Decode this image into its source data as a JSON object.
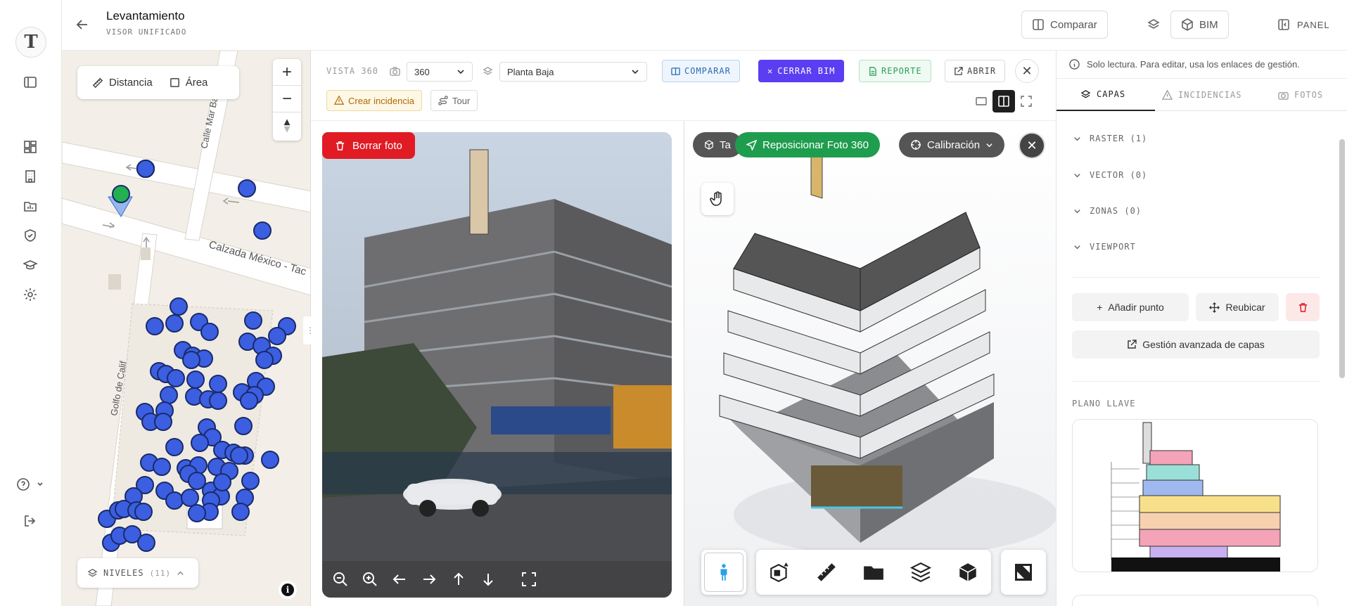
{
  "header": {
    "title": "Levantamiento",
    "subtitle": "VISOR UNIFICADO",
    "compare_label": "Comparar",
    "bim_label": "BIM",
    "panel_label": "PANEL"
  },
  "rail": {
    "logo_letter": "T",
    "icons": [
      "sidebar-toggle-icon",
      "dashboard-icon",
      "building-icon",
      "folder-chart-icon",
      "shield-check-icon",
      "graduation-cap-icon",
      "settings-icon",
      "help-icon",
      "logout-icon"
    ]
  },
  "map": {
    "distance_label": "Distancia",
    "area_label": "Área",
    "zoom_in": "+",
    "zoom_out": "−",
    "street_1": "Calle Mar Baffin",
    "street_2": "Calzada México - Tac",
    "street_3": "Golfo de Calif",
    "levels_label": "NIVELES",
    "levels_count": "(11)",
    "info_glyph": "i"
  },
  "toolbar": {
    "vista_label": "VISTA 360",
    "mode_value": "360",
    "floor_value": "Planta Baja",
    "compare_label": "COMPARAR",
    "close_bim_label": "CERRAR BIM",
    "report_label": "REPORTE",
    "open_label": "ABRIR",
    "incident_label": "Crear incidencia",
    "tour_label": "Tour"
  },
  "photo": {
    "delete_label": "Borrar foto"
  },
  "bim": {
    "tab_label": "Ta",
    "reposition_label": "Reposicionar Foto 360",
    "calibration_label": "Calibración"
  },
  "right_panel": {
    "notice": "Solo lectura. Para editar, usa los enlaces de gestión.",
    "tabs": [
      {
        "label": "CAPAS",
        "icon": "layers-icon"
      },
      {
        "label": "INCIDENCIAS",
        "icon": "warning-icon"
      },
      {
        "label": "FOTOS",
        "icon": "camera-icon"
      }
    ],
    "layers": [
      "RASTER (1)",
      "VECTOR (0)",
      "ZONAS (0)",
      "VIEWPORT"
    ],
    "add_point_label": "Añadir punto",
    "relocate_label": "Reubicar",
    "advanced_label": "Gestión avanzada de capas",
    "key_plan_label": "PLANO LLAVE"
  },
  "colors": {
    "accent_purple": "#5b3ef2",
    "danger": "#e01b24",
    "success": "#1f9d4e",
    "map_marker": "#3b5fe0"
  }
}
